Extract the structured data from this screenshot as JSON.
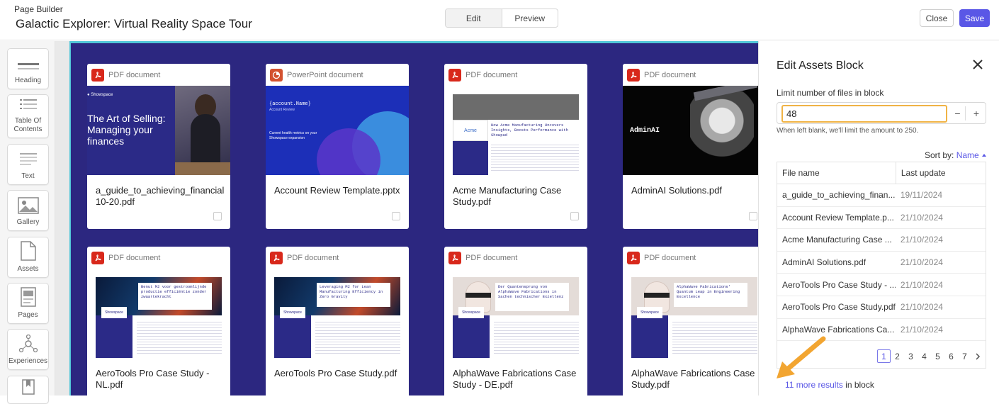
{
  "header": {
    "breadcrumb": "Page Builder",
    "title": "Galactic Explorer: Virtual Reality Space Tour",
    "modes": [
      "Edit",
      "Preview"
    ],
    "active_mode": "Edit",
    "close_label": "Close",
    "save_label": "Save",
    "accent_color": "#5a57e6"
  },
  "toolbox": {
    "items": [
      {
        "label": "Heading",
        "icon": "heading-icon"
      },
      {
        "label": "Table Of Contents",
        "icon": "toc-icon"
      },
      {
        "label": "Text",
        "icon": "text-icon"
      },
      {
        "label": "Gallery",
        "icon": "image-icon"
      },
      {
        "label": "Assets",
        "icon": "document-icon"
      },
      {
        "label": "Pages",
        "icon": "pages-icon"
      },
      {
        "label": "Experiences",
        "icon": "network-icon"
      }
    ]
  },
  "canvas": {
    "background_color": "#2c2780",
    "cards": [
      {
        "type": "PDF document",
        "name": "a_guide_to_achieving_financial 10-20.pdf",
        "thumb_title": "The Art of Selling: Managing your finances"
      },
      {
        "type": "PowerPoint document",
        "name": "Account Review Template.pptx",
        "thumb_title": "{account.Name}",
        "thumb_sub": "Account Review",
        "thumb_body": "Current health metrics on your Showspace expansion"
      },
      {
        "type": "PDF document",
        "name": "Acme Manufacturing Case Study.pdf",
        "thumb_title": "How Acme Manufacturing Uncovers Insights, Boosts Performance with Showpad"
      },
      {
        "type": "PDF document",
        "name": "AdminAI Solutions.pdf",
        "thumb_title": "AdminAI"
      },
      {
        "type": "PDF document",
        "name": "AeroTools Pro Case Study - NL.pdf",
        "thumb_title": "Benut M2 voor gestroomlijnde productie efficiëntie zonder zwaartekracht"
      },
      {
        "type": "PDF document",
        "name": "AeroTools Pro Case Study.pdf",
        "thumb_title": "Leveraging M2 for Lean Manufacturing Efficiency in Zero Gravity"
      },
      {
        "type": "PDF document",
        "name": "AlphaWave Fabrications Case Study - DE.pdf",
        "thumb_title": "Der Quantensprung von AlphaWave Fabrications in Sachen technischer Exzellenz"
      },
      {
        "type": "PDF document",
        "name": "AlphaWave Fabrications Case Study.pdf",
        "thumb_title": "AlphaWave Fabrications' Quantum Leap in Engineering Excellence"
      }
    ]
  },
  "panel": {
    "title": "Edit Assets Block",
    "limit_label": "Limit number of files in block",
    "limit_value": "48",
    "minus": "−",
    "plus": "+",
    "hint": "When left blank, we'll limit the amount to 250.",
    "sort_prefix": "Sort by:",
    "sort_value": "Name",
    "columns": [
      "File name",
      "Last update"
    ],
    "rows": [
      {
        "name": "a_guide_to_achieving_finan...",
        "date": "19/11/2024"
      },
      {
        "name": "Account Review Template.p...",
        "date": "21/10/2024"
      },
      {
        "name": "Acme Manufacturing Case ...",
        "date": "21/10/2024"
      },
      {
        "name": "AdminAI Solutions.pdf",
        "date": "21/10/2024"
      },
      {
        "name": "AeroTools Pro Case Study - ...",
        "date": "21/10/2024"
      },
      {
        "name": "AeroTools Pro Case Study.pdf",
        "date": "21/10/2024"
      },
      {
        "name": "AlphaWave Fabrications Ca...",
        "date": "21/10/2024"
      }
    ],
    "pages": [
      "1",
      "2",
      "3",
      "4",
      "5",
      "6",
      "7"
    ],
    "current_page": "1",
    "more_link": "11 more results",
    "more_suffix": " in block"
  }
}
